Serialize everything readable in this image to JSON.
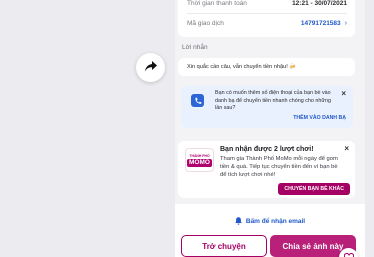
{
  "share": {
    "icon": "share-arrow-icon"
  },
  "transaction": {
    "time_label": "Thời gian thanh toán",
    "time_value": "12:21 - 30/07/2021",
    "code_label": "Mã giao dịch",
    "code_value": "14791721583"
  },
  "message": {
    "label": "Lời nhắn",
    "text": "Xin quắc cần câu, vẫn chuyển tiền nhậu! 🍻"
  },
  "contact_prompt": {
    "text": "Bạn có muốn thêm số điện thoại của bạn bè vào danh bạ để chuyển tiền nhanh chóng cho những lần sau?",
    "action": "THÊM VÀO DANH BẠ",
    "close": "×",
    "icon": "contact-book-icon"
  },
  "promo": {
    "logo_top": "THÀNH PHỐ",
    "logo_main": "MOMO",
    "title": "Bạn nhận được 2 lượt chơi!",
    "body": "Tham gia Thành Phố MoMo mỗi ngày để gom tiền & quà. Tiếp tục chuyển tiền đến ví bạn bè để tích lượt chơi nhé!",
    "button": "CHUYỂN BẠN BÈ KHÁC",
    "close": "×"
  },
  "email": {
    "label": "Bấm để nhận email",
    "icon": "bell-icon"
  },
  "actions": {
    "back": "Trở chuyện",
    "share": "Chia sẻ ảnh này"
  },
  "colors": {
    "brand": "#a50064",
    "link": "#2058c9",
    "info_bg": "#eaf1fe"
  }
}
